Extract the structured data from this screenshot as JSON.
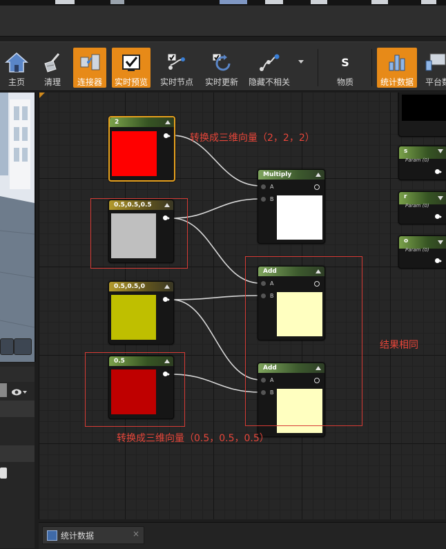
{
  "toolbar": {
    "items": [
      {
        "label": "主页",
        "icon": "home-icon",
        "active": false
      },
      {
        "label": "清理",
        "icon": "broom-icon",
        "active": false
      },
      {
        "label": "连接器",
        "icon": "connector-icon",
        "active": true
      },
      {
        "label": "实时预览",
        "icon": "live-preview-icon",
        "active": true
      },
      {
        "label": "实时节点",
        "icon": "live-nodes-icon",
        "active": false
      },
      {
        "label": "实时更新",
        "icon": "live-update-icon",
        "active": false
      },
      {
        "label": "隐藏不相关",
        "icon": "hide-unrelated-icon",
        "active": false
      },
      {
        "label": "物质",
        "icon": "substance-icon",
        "active": false
      },
      {
        "label": "统计数据",
        "icon": "stats-icon",
        "active": true
      },
      {
        "label": "平台数",
        "icon": "platform-stats-icon",
        "active": false
      }
    ]
  },
  "nodes": {
    "const2": {
      "title": "2",
      "color": "#ff0000"
    },
    "const05v": {
      "title": "0.5,0.5,0.5",
      "color": "#bfbfbf"
    },
    "const050": {
      "title": "0.5,0.5,0",
      "color": "#bfbf00"
    },
    "const05": {
      "title": "0.5",
      "color": "#bf0000"
    },
    "multiply": {
      "title": "Multiply",
      "in_a": "A",
      "in_b": "B",
      "preview": "#ffffff"
    },
    "add1": {
      "title": "Add",
      "in_a": "A",
      "in_b": "B",
      "preview": "#ffffc0"
    },
    "add2": {
      "title": "Add",
      "in_a": "A",
      "in_b": "B",
      "preview": "#ffffc0"
    }
  },
  "params": [
    {
      "name": "s",
      "sub": "Param (0)"
    },
    {
      "name": "r",
      "sub": "Param (0)"
    },
    {
      "name": "o",
      "sub": "Param (0)"
    }
  ],
  "annotations": {
    "top": "转换成三维向量（2，2，2）",
    "result": "结果相同",
    "bottom": "转换成三维向量（0.5，0.5，0.5）"
  },
  "bottom_tab": {
    "label": "统计数据",
    "close": "×"
  },
  "colors": {
    "accent": "#e78a18",
    "annotation": "#e8463a"
  }
}
